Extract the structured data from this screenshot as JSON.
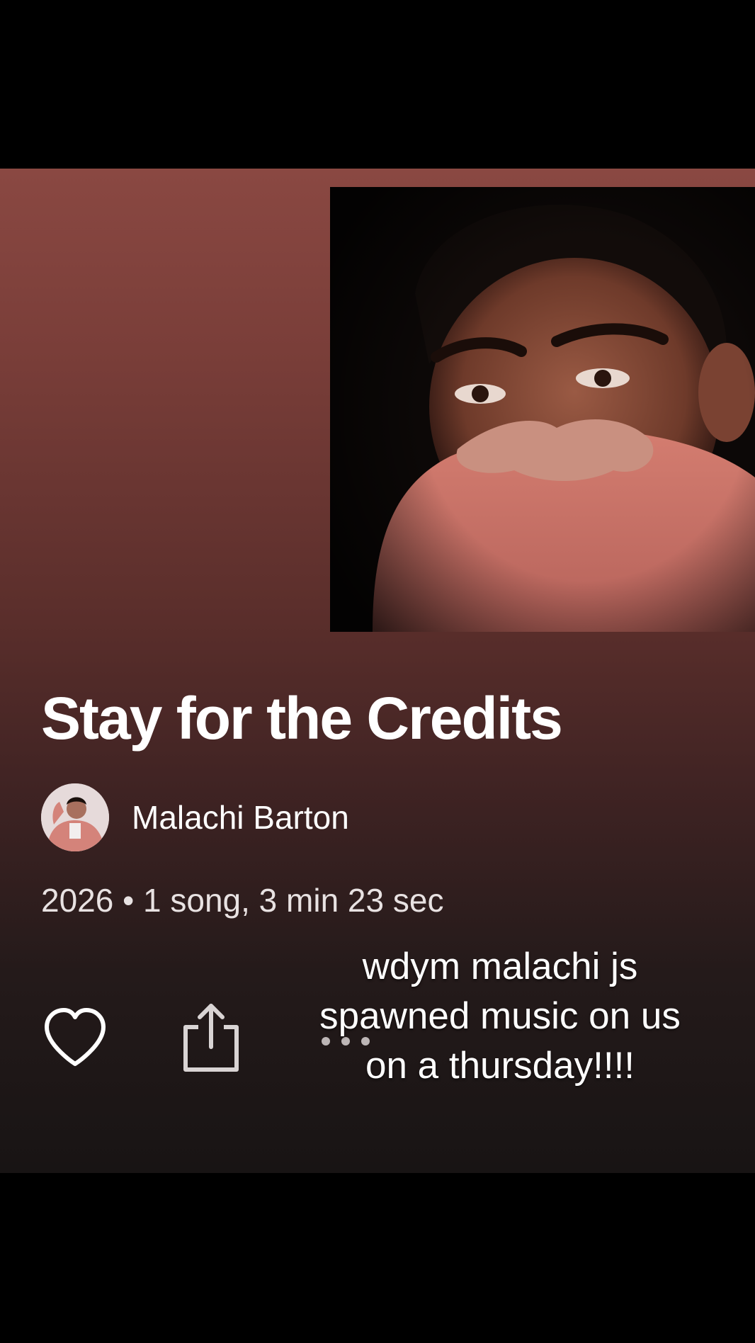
{
  "album": {
    "title": "Stay for the Credits",
    "artist": "Malachi Barton",
    "meta": "2026 • 1 song, 3 min 23 sec"
  },
  "actions": {
    "like_icon": "heart-icon",
    "share_icon": "share-icon",
    "more_icon": "more-icon"
  },
  "overlay": {
    "caption_lines": [
      "wdym malachi js",
      "spawned music on us",
      "on a thursday!!!!"
    ]
  },
  "colors": {
    "gradient_top": "#8a4842",
    "gradient_bottom": "#181414",
    "text": "#ffffff"
  }
}
